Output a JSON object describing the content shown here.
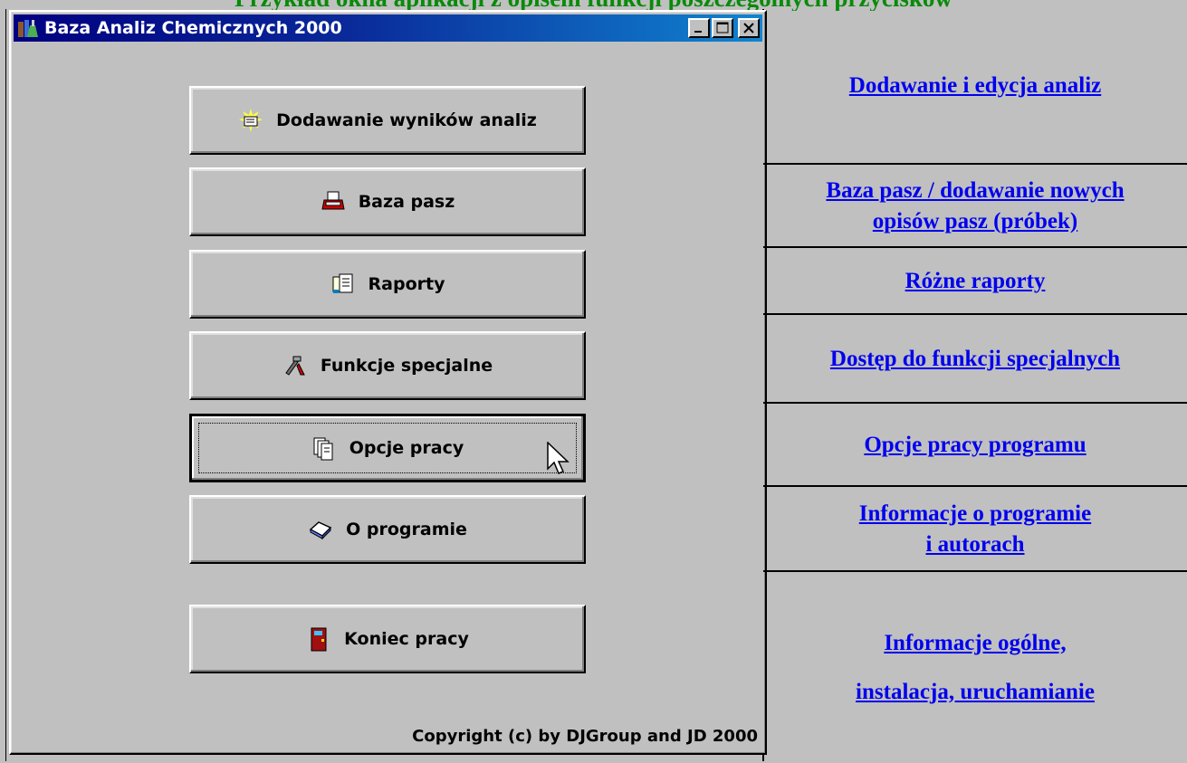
{
  "heading": "Przykład okna aplikacji z opisem funkcji poszczególnych przycisków",
  "window": {
    "title": "Baza Analiz Chemicznych 2000",
    "copyright": "Copyright (c) by DJGroup and  JD 2000"
  },
  "buttons": [
    {
      "label": "Dodawanie wyników analiz",
      "icon": "edit-note-icon"
    },
    {
      "label": "Baza pasz",
      "icon": "printer-icon"
    },
    {
      "label": "Raporty",
      "icon": "report-icon"
    },
    {
      "label": "Funkcje specjalne",
      "icon": "tools-icon"
    },
    {
      "label": "Opcje pracy",
      "icon": "pages-icon",
      "focused": true
    },
    {
      "label": "O programie",
      "icon": "book-icon"
    },
    {
      "label": "Koniec pracy",
      "icon": "door-icon"
    }
  ],
  "links": [
    {
      "lines": [
        "Dodawanie i edycja  analiz"
      ]
    },
    {
      "lines": [
        "Baza pasz / dodawanie nowych",
        "opisów pasz (próbek)"
      ]
    },
    {
      "lines": [
        "Różne raporty"
      ]
    },
    {
      "lines": [
        "Dostęp do funkcji specjalnych"
      ]
    },
    {
      "lines": [
        "Opcje pracy programu"
      ]
    },
    {
      "lines": [
        "Informacje o programie",
        "i autorach"
      ]
    },
    {
      "lines": [
        "Informacje ogólne,",
        "instalacja, uruchamianie"
      ]
    }
  ],
  "colors": {
    "face": "#c0c0c0",
    "title_bar_start": "#000080",
    "title_bar_end": "#1084d0",
    "link": "#0000ee",
    "heading": "#0a8a0a"
  }
}
